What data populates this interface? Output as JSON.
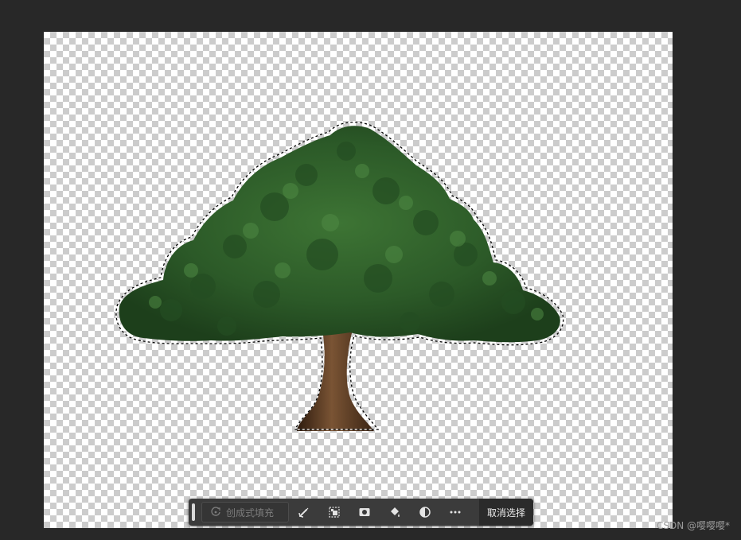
{
  "context_bar": {
    "generative_fill_label": "创成式填充",
    "deselect_label": "取消选择",
    "tools": [
      {
        "name": "modify-selection-icon"
      },
      {
        "name": "invert-selection-icon"
      },
      {
        "name": "create-mask-icon"
      },
      {
        "name": "fill-selection-icon"
      },
      {
        "name": "adjustment-layer-icon"
      },
      {
        "name": "more-options-icon"
      }
    ]
  },
  "watermark": "CSDN @嘤嘤嘤*",
  "colors": {
    "workspace": "#282828",
    "toolbar": "#3b3b3b",
    "foliage": "#2f5f2a",
    "trunk": "#5a3a22"
  }
}
